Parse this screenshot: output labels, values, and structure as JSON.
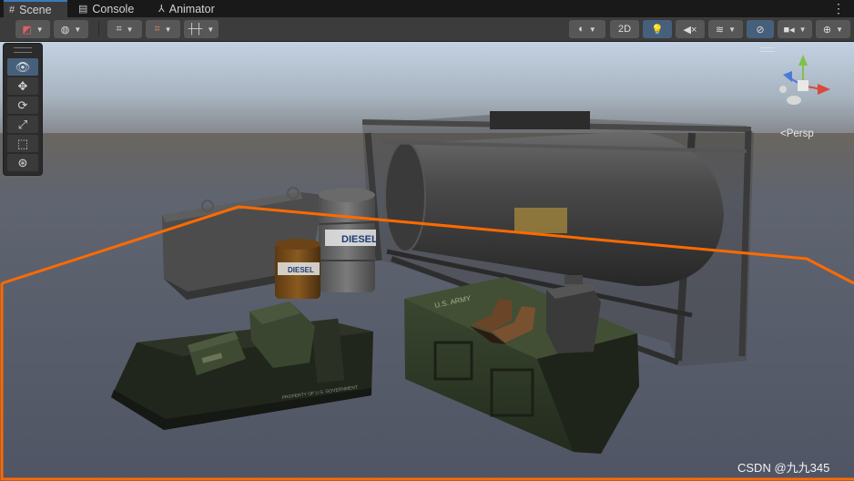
{
  "tabs": [
    {
      "label": "Scene",
      "icon": "grid-icon",
      "active": true
    },
    {
      "label": "Console",
      "icon": "console-icon",
      "active": false
    },
    {
      "label": "Animator",
      "icon": "animator-icon",
      "active": false
    }
  ],
  "toolbar": {
    "mode_2d_label": "2D"
  },
  "scene": {
    "barrel_small_label": "DIESEL",
    "barrel_large_label": "DIESEL",
    "box_stencil": "U.S. ARMY",
    "crate_stencil": "PROPERTY OF U.S. GOVERNMENT"
  },
  "gizmo": {
    "projection_label": "<Persp"
  },
  "watermark": "CSDN @九九345",
  "colors": {
    "selection_outline": "#ff6a00",
    "accent": "#46607c",
    "tab_highlight": "#3a79bb"
  }
}
